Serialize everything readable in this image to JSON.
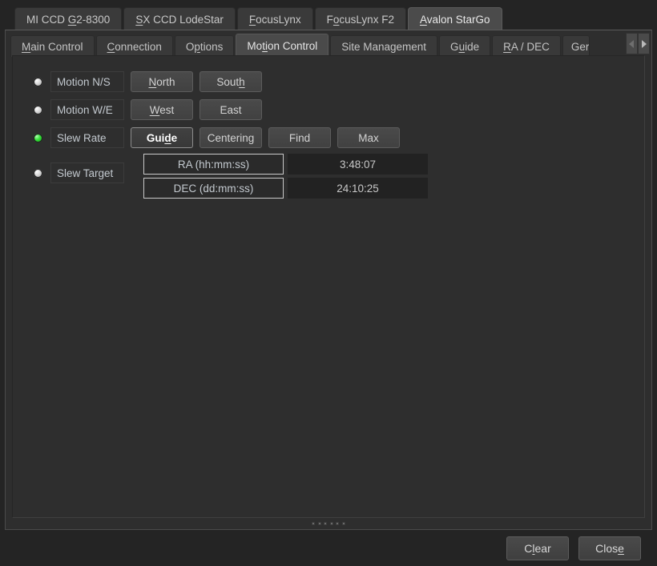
{
  "colors": {
    "window_bg": "#242424",
    "panel_bg": "#2e2e2e",
    "tab_active_bg": "#4b4b4b",
    "text": "#cfcfcf",
    "led_on": "#36e23a",
    "led_off": "#d8d8d8",
    "field_border": "#c9c9c9"
  },
  "device_tabs": [
    {
      "label": "MI CCD G2-8300",
      "pre": "MI CCD ",
      "mnemonic": "G",
      "post": "2-8300",
      "active": false
    },
    {
      "label": "SX CCD LodeStar",
      "pre": "",
      "mnemonic": "S",
      "post": "X CCD LodeStar",
      "active": false
    },
    {
      "label": "FocusLynx",
      "pre": "",
      "mnemonic": "F",
      "post": "ocusLynx",
      "active": false
    },
    {
      "label": "FocusLynx F2",
      "pre": "F",
      "mnemonic": "o",
      "post": "cusLynx F2",
      "active": false
    },
    {
      "label": "Avalon StarGo",
      "pre": "",
      "mnemonic": "A",
      "post": "valon StarGo",
      "active": true
    }
  ],
  "sub_tabs": [
    {
      "label": "Main Control",
      "pre": "",
      "mnemonic": "M",
      "post": "ain Control",
      "active": false
    },
    {
      "label": "Connection",
      "pre": "",
      "mnemonic": "C",
      "post": "onnection",
      "active": false
    },
    {
      "label": "Options",
      "pre": "O",
      "mnemonic": "p",
      "post": "tions",
      "active": false
    },
    {
      "label": "Motion Control",
      "pre": "Mo",
      "mnemonic": "ti",
      "post": "on Control",
      "active": true
    },
    {
      "label": "Site Management",
      "pre": "Site Management",
      "mnemonic": "",
      "post": "",
      "active": false
    },
    {
      "label": "Guide",
      "pre": "G",
      "mnemonic": "u",
      "post": "ide",
      "active": false
    },
    {
      "label": "RA / DEC",
      "pre": "",
      "mnemonic": "R",
      "post": "A / DEC",
      "active": false
    },
    {
      "label": "Ger",
      "pre": "Ger",
      "mnemonic": "",
      "post": "",
      "active": false
    }
  ],
  "tab_scroll": {
    "left_icon": "chevron-left-icon",
    "right_icon": "chevron-right-icon"
  },
  "motion_control": {
    "rows": [
      {
        "led": "off",
        "label": "Motion N/S",
        "buttons": [
          {
            "label": "North",
            "pre": "",
            "mnemonic": "N",
            "post": "orth",
            "selected": false
          },
          {
            "label": "South",
            "pre": "Sout",
            "mnemonic": "h",
            "post": "",
            "selected": false
          }
        ]
      },
      {
        "led": "off",
        "label": "Motion W/E",
        "buttons": [
          {
            "label": "West",
            "pre": "",
            "mnemonic": "W",
            "post": "est",
            "selected": false
          },
          {
            "label": "East",
            "pre": "East",
            "mnemonic": "",
            "post": "",
            "selected": false
          }
        ]
      },
      {
        "led": "on",
        "label": "Slew Rate",
        "buttons": [
          {
            "label": "Guide",
            "pre": "Gui",
            "mnemonic": "d",
            "post": "e",
            "selected": true
          },
          {
            "label": "Centering",
            "pre": "Centering",
            "mnemonic": "",
            "post": "",
            "selected": false
          },
          {
            "label": "Find",
            "pre": "Find",
            "mnemonic": "",
            "post": "",
            "selected": false
          },
          {
            "label": "Max",
            "pre": "Max",
            "mnemonic": "",
            "post": "",
            "selected": false
          }
        ]
      }
    ],
    "slew_target": {
      "led": "off",
      "label": "Slew Target",
      "ra": {
        "field_label": "RA (hh:mm:ss)",
        "value": "3:48:07"
      },
      "dec": {
        "field_label": "DEC (dd:mm:ss)",
        "value": "24:10:25"
      }
    }
  },
  "footer": {
    "clear": {
      "label": "Clear",
      "pre": "C",
      "mnemonic": "l",
      "post": "ear"
    },
    "close": {
      "label": "Close",
      "pre": "Clos",
      "mnemonic": "e",
      "post": ""
    }
  }
}
